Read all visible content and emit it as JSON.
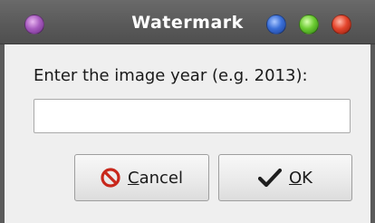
{
  "window": {
    "title": "Watermark"
  },
  "dialog": {
    "prompt": "Enter the image year (e.g. 2013):",
    "input_value": "",
    "input_placeholder": ""
  },
  "buttons": {
    "cancel": {
      "mnemonic": "C",
      "rest": "ancel",
      "icon": "cancel-icon"
    },
    "ok": {
      "mnemonic": "O",
      "rest": "K",
      "icon": "checkmark-icon"
    }
  },
  "titlebar_orbs": [
    {
      "name": "menu-orb",
      "color": "#a85cc0"
    },
    {
      "name": "minimize-orb",
      "color": "#3a6fd8"
    },
    {
      "name": "maximize-orb",
      "color": "#6ccc32"
    },
    {
      "name": "close-orb",
      "color": "#e4452c"
    }
  ]
}
